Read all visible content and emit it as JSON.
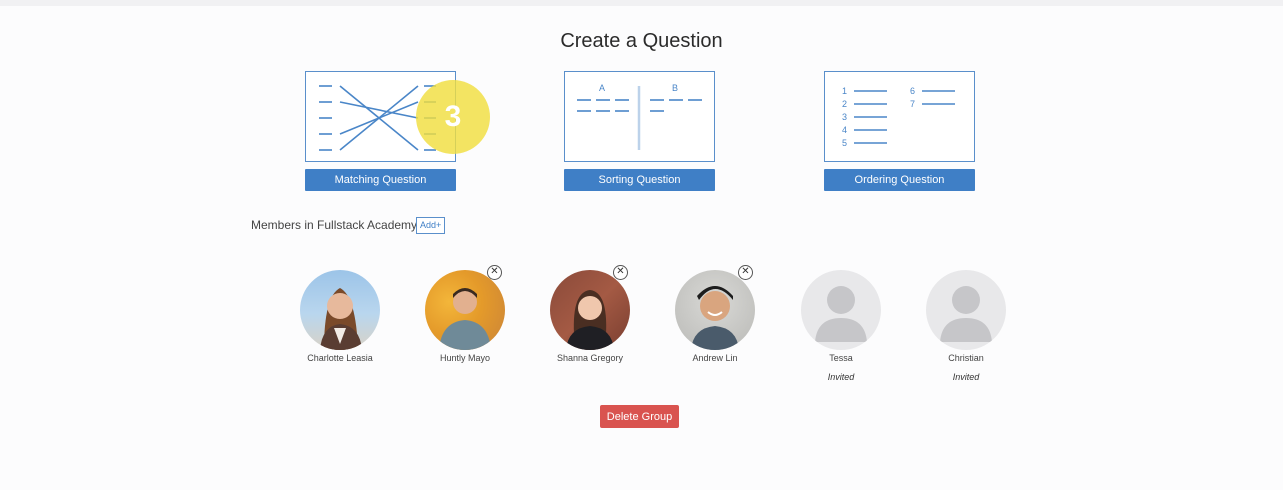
{
  "page": {
    "title": "Create a Question"
  },
  "question_types": [
    {
      "label": "Matching Question",
      "icon": "matching-diagram-icon"
    },
    {
      "label": "Sorting Question",
      "icon": "sorting-diagram-icon",
      "col_a": "A",
      "col_b": "B"
    },
    {
      "label": "Ordering Question",
      "icon": "ordering-diagram-icon",
      "numbers": [
        "1",
        "2",
        "3",
        "4",
        "5",
        "6",
        "7"
      ]
    }
  ],
  "step_badge": "3",
  "members_section": {
    "label": "Members in Fullstack Academy",
    "add_label": "Add+"
  },
  "members": [
    {
      "name": "Charlotte Leasia",
      "status": "",
      "removable": false
    },
    {
      "name": "Huntly Mayo",
      "status": "",
      "removable": true
    },
    {
      "name": "Shanna Gregory",
      "status": "",
      "removable": true
    },
    {
      "name": "Andrew Lin",
      "status": "",
      "removable": true
    },
    {
      "name": "Tessa",
      "status": "Invited",
      "removable": false
    },
    {
      "name": "Christian",
      "status": "Invited",
      "removable": false
    }
  ],
  "delete_label": "Delete Group",
  "colors": {
    "primary": "#3f7fc6",
    "danger": "#d9534f",
    "badge": "#f0de40"
  }
}
